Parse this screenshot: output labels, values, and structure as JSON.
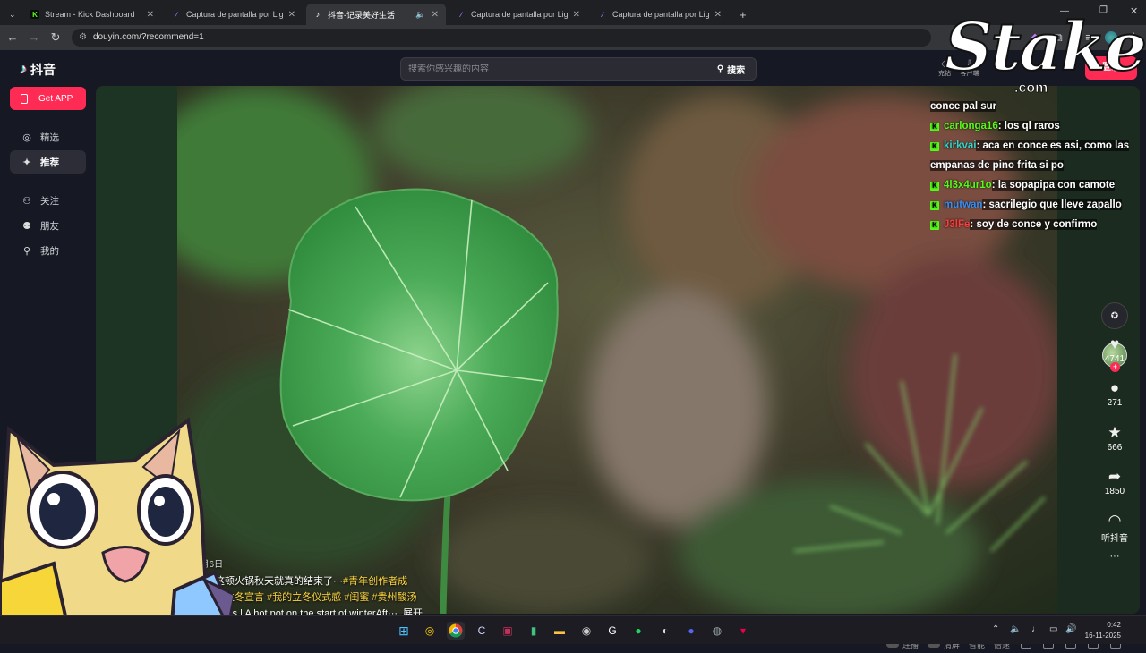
{
  "browser": {
    "tabs": [
      {
        "title": "Stream - Kick Dashboard",
        "favicon": "kick-icon",
        "color": "#53fc18"
      },
      {
        "title": "Captura de pantalla por Lightsh",
        "favicon": "lightshot-icon",
        "color": "#a070ff"
      },
      {
        "title": "抖音-记录美好生活",
        "favicon": "tiktok-icon",
        "color": "#ffffff",
        "active": true
      },
      {
        "title": "Captura de pantalla por Lightsh",
        "favicon": "lightshot-icon",
        "color": "#a070ff"
      },
      {
        "title": "Captura de pantalla por Lightsh",
        "favicon": "lightshot-icon",
        "color": "#a070ff"
      }
    ],
    "new_tab": "+",
    "url": "douyin.com/?recommend=1",
    "window_controls": [
      "minimize-icon",
      "maximize-icon",
      "close-icon"
    ]
  },
  "header": {
    "logo": "抖音",
    "search_placeholder": "搜索你感兴趣的内容",
    "search_button": "搜索",
    "mini_1": "充钻",
    "mini_2": "客户端",
    "login": "登录"
  },
  "sidebar": {
    "get_app": "Get APP",
    "items": [
      {
        "label": "精选",
        "icon": "compass-icon"
      },
      {
        "label": "推荐",
        "icon": "sparkle-icon",
        "active": true
      },
      {
        "label": "关注",
        "icon": "follow-icon"
      },
      {
        "label": "朋友",
        "icon": "friends-icon"
      },
      {
        "label": "我的",
        "icon": "user-icon"
      }
    ]
  },
  "video": {
    "date": "1月6日",
    "caption_line1": "吃完这顿火锅秋天就真的结束了···",
    "caption_tag1": "#青年创作者成",
    "caption_line2": "是我的立冬宣言 #我的立冬仪式感 #闺蜜 #贵州酸汤",
    "caption_line3": "and fields | A hot pot on the start of winterAft···",
    "expand": "展开",
    "progress": 0.62,
    "likes": "4741",
    "comments": "271",
    "favorites": "666",
    "shares": "1850",
    "listen": "听抖音",
    "more": "···",
    "controls": {
      "continuous": "连播",
      "clear": "清屏",
      "smart": "智能",
      "speed": "倍速"
    }
  },
  "chat": [
    {
      "user": "",
      "text": "conce pal sur",
      "user_color": "#ffffff"
    },
    {
      "user": "carlonga16",
      "text": ": los ql raros",
      "user_color": "#53fc18"
    },
    {
      "user": "kirkvai",
      "text": ": aca en conce es asi, como las empanas de pino frita si po",
      "user_color": "#30d5c8"
    },
    {
      "user": "4l3x4ur1o",
      "text": ": la sopapipa con camote",
      "user_color": "#53fc18"
    },
    {
      "user": "mutwan",
      "text": ": sacrilegio que lleve zapallo",
      "user_color": "#3a8ef0"
    },
    {
      "user": "J3lFe",
      "text": ": soy de conce y confirmo",
      "user_color": "#ff3b3b"
    }
  ],
  "overlay": {
    "brand": "Stake",
    "brand_domain": ".com"
  },
  "taskbar": {
    "icons": [
      "windows-icon",
      "norton-icon",
      "chrome-icon",
      "ccleaner-icon",
      "kick-app-icon",
      "app-icon",
      "folder-icon",
      "obs-icon",
      "github-icon",
      "spotify-icon",
      "steam-icon",
      "discord-icon",
      "media-icon",
      "dashboard-icon"
    ],
    "time": "0:42",
    "date": "16-11-2025"
  }
}
